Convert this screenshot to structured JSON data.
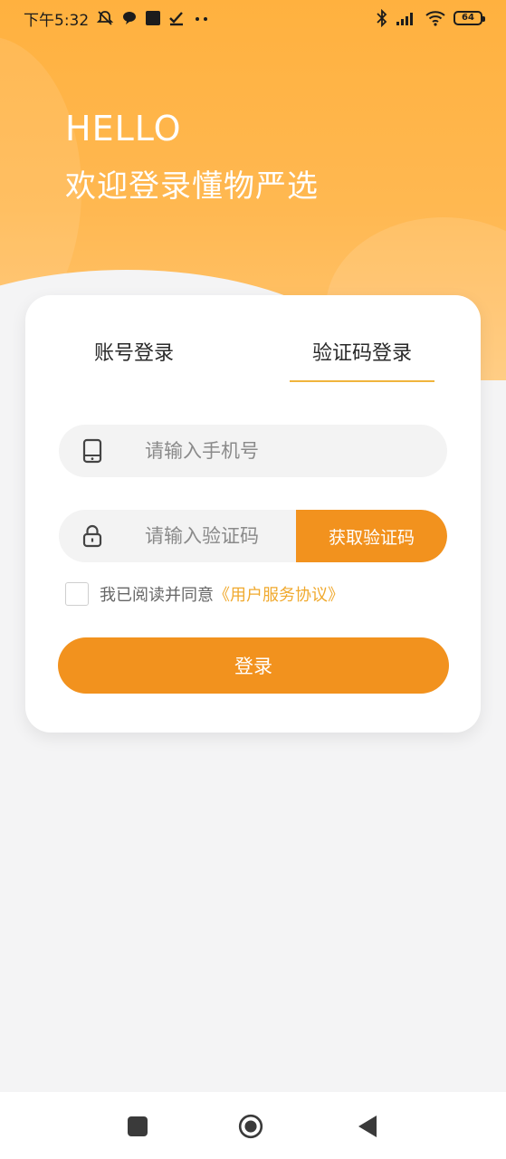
{
  "status_bar": {
    "time": "下午5:32",
    "battery": "64"
  },
  "hero": {
    "hello": "HELLO",
    "welcome": "欢迎登录懂物严选"
  },
  "login_card": {
    "tabs": [
      {
        "label": "账号登录",
        "active": false
      },
      {
        "label": "验证码登录",
        "active": true
      }
    ],
    "phone_input": {
      "placeholder": "请输入手机号",
      "value": ""
    },
    "code_input": {
      "placeholder": "请输入验证码",
      "value": ""
    },
    "get_code_label": "获取验证码",
    "agreement": {
      "checked": false,
      "text": "我已阅读并同意",
      "link": "《用户服务协议》"
    },
    "login_label": "登录"
  },
  "icons": {
    "phone": "phone-icon",
    "lock": "lock-icon",
    "nav_recent": "square-icon",
    "nav_home": "circle-icon",
    "nav_back": "triangle-back-icon"
  },
  "colors": {
    "accent": "#f2921e",
    "hero": "#ffb13f",
    "link": "#f0a92e",
    "tab_underline": "#f0b43c"
  }
}
